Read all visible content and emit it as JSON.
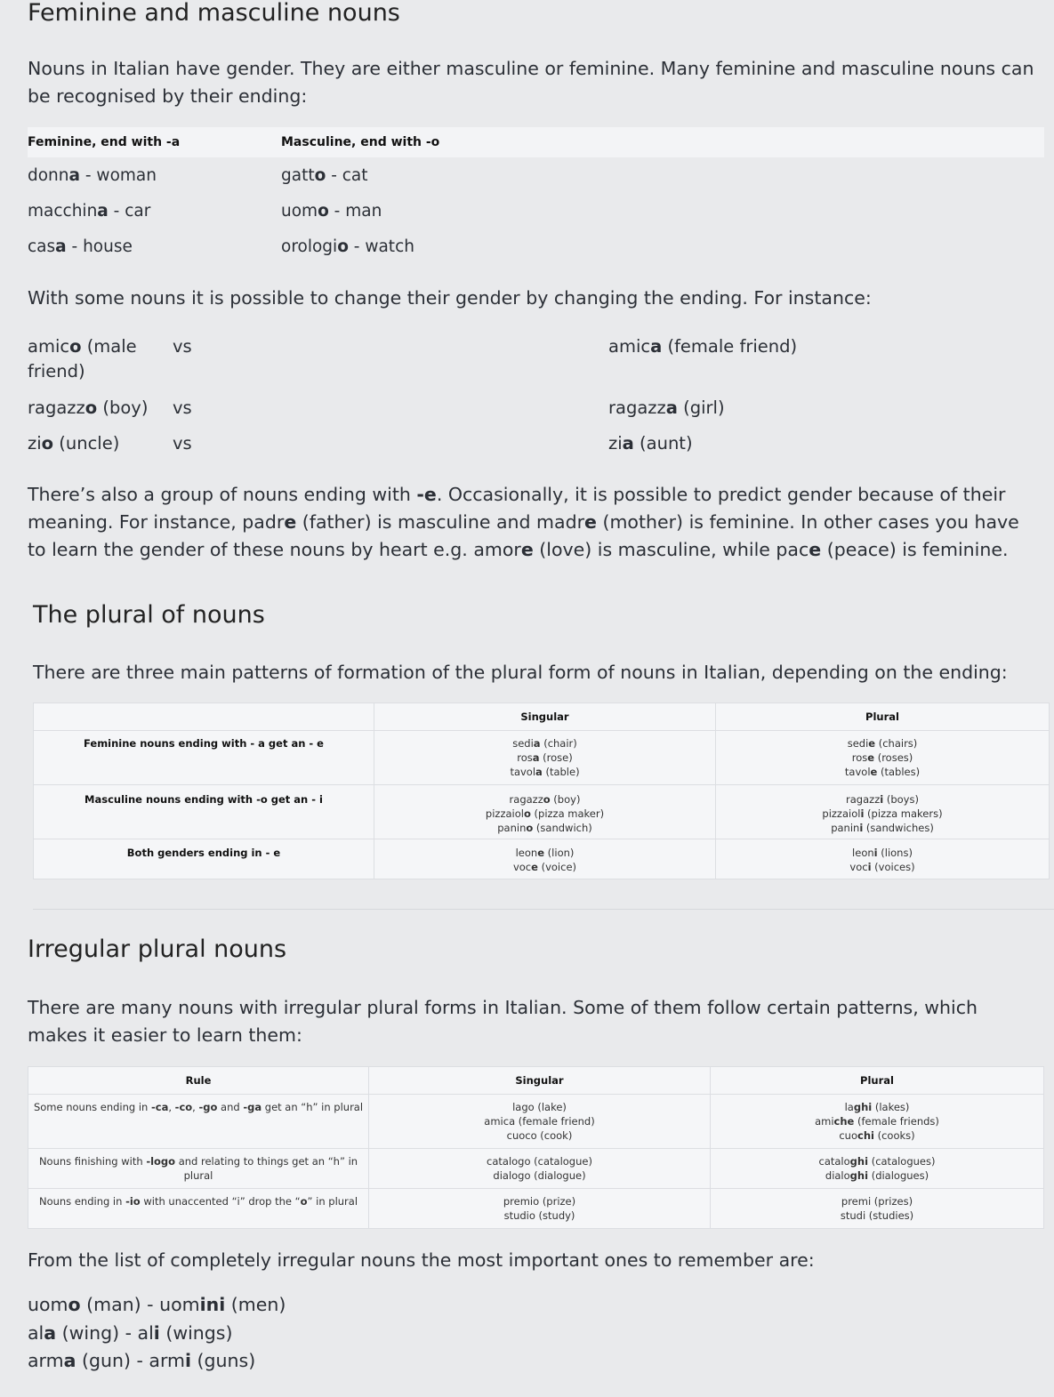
{
  "h_gender": "Feminine and masculine nouns",
  "p_intro": "Nouns in Italian have gender. They are either masculine or feminine. Many feminine and masculine nouns can be recognised by their ending:",
  "gender_table": {
    "head_fem": "Feminine, end with -a",
    "head_masc": "Masculine, end with -o",
    "rows": [
      {
        "fem": [
          {
            "t": "donn"
          },
          {
            "t": "a",
            "b": 1
          },
          {
            "t": " - woman"
          }
        ],
        "masc": [
          {
            "t": "gatt"
          },
          {
            "t": "o",
            "b": 1
          },
          {
            "t": " - cat"
          }
        ]
      },
      {
        "fem": [
          {
            "t": "macchin"
          },
          {
            "t": "a",
            "b": 1
          },
          {
            "t": " - car"
          }
        ],
        "masc": [
          {
            "t": "uom"
          },
          {
            "t": "o",
            "b": 1
          },
          {
            "t": " - man"
          }
        ]
      },
      {
        "fem": [
          {
            "t": "cas"
          },
          {
            "t": "a",
            "b": 1
          },
          {
            "t": " - house"
          }
        ],
        "masc": [
          {
            "t": "orologi"
          },
          {
            "t": "o",
            "b": 1
          },
          {
            "t": " - watch"
          }
        ]
      }
    ]
  },
  "p_change": "With some nouns it is possible to change their gender by changing the ending. For instance:",
  "change_rows": [
    {
      "left": [
        {
          "t": "amic"
        },
        {
          "t": "o",
          "b": 1
        },
        {
          "t": " (male friend)"
        }
      ],
      "vs": "vs",
      "right": [
        {
          "t": "amic"
        },
        {
          "t": "a",
          "b": 1
        },
        {
          "t": " (female friend)"
        }
      ]
    },
    {
      "left": [
        {
          "t": "ragazz"
        },
        {
          "t": "o",
          "b": 1
        },
        {
          "t": " (boy)"
        }
      ],
      "vs": "vs",
      "right": [
        {
          "t": "ragazz"
        },
        {
          "t": "a",
          "b": 1
        },
        {
          "t": " (girl)"
        }
      ]
    },
    {
      "left": [
        {
          "t": "zi"
        },
        {
          "t": "o",
          "b": 1
        },
        {
          "t": " (uncle)"
        }
      ],
      "vs": "vs",
      "right": [
        {
          "t": "zi"
        },
        {
          "t": "a",
          "b": 1
        },
        {
          "t": " (aunt)"
        }
      ]
    }
  ],
  "p_e_group": [
    {
      "t": "There’s also a group of nouns ending with "
    },
    {
      "t": "-e",
      "b": 1
    },
    {
      "t": ". Occasionally, it is possible to predict gender because of their meaning. For instance, padr"
    },
    {
      "t": "e",
      "b": 1
    },
    {
      "t": " (father) is masculine and madr"
    },
    {
      "t": "e",
      "b": 1
    },
    {
      "t": " (mother) is feminine. In other cases you have to learn the gender of these nouns by heart e.g. amor"
    },
    {
      "t": "e",
      "b": 1
    },
    {
      "t": " (love) is masculine, while pac"
    },
    {
      "t": "e",
      "b": 1
    },
    {
      "t": " (peace) is feminine."
    }
  ],
  "h_plural": "The plural of nouns",
  "p_plural": "There are three main patterns of formation of the plural form of nouns in Italian, depending on the ending:",
  "plural_table": {
    "head_singular": "Singular",
    "head_plural": "Plural",
    "rows": [
      {
        "rule": "Feminine nouns ending with - a get an - e",
        "singular": [
          [
            {
              "t": "sedi"
            },
            {
              "t": "a",
              "b": 1
            },
            {
              "t": " (chair)"
            }
          ],
          [
            {
              "t": "ros"
            },
            {
              "t": "a",
              "b": 1
            },
            {
              "t": " (rose)"
            }
          ],
          [
            {
              "t": "tavol"
            },
            {
              "t": "a",
              "b": 1
            },
            {
              "t": " (table)"
            }
          ]
        ],
        "plural": [
          [
            {
              "t": "sedi"
            },
            {
              "t": "e",
              "b": 1
            },
            {
              "t": " (chairs)"
            }
          ],
          [
            {
              "t": "ros"
            },
            {
              "t": "e",
              "b": 1
            },
            {
              "t": " (roses)"
            }
          ],
          [
            {
              "t": "tavol"
            },
            {
              "t": "e",
              "b": 1
            },
            {
              "t": " (tables)"
            }
          ]
        ]
      },
      {
        "rule": "Masculine nouns ending with -o get an - i",
        "singular": [
          [
            {
              "t": "ragazz"
            },
            {
              "t": "o",
              "b": 1
            },
            {
              "t": " (boy)"
            }
          ],
          [
            {
              "t": "pizzaiol"
            },
            {
              "t": "o",
              "b": 1
            },
            {
              "t": " (pizza maker)"
            }
          ],
          [
            {
              "t": "panin"
            },
            {
              "t": "o",
              "b": 1
            },
            {
              "t": " (sandwich)"
            }
          ]
        ],
        "plural": [
          [
            {
              "t": "ragazz"
            },
            {
              "t": "i",
              "b": 1
            },
            {
              "t": " (boys)"
            }
          ],
          [
            {
              "t": "pizzaiol"
            },
            {
              "t": "i",
              "b": 1
            },
            {
              "t": " (pizza makers)"
            }
          ],
          [
            {
              "t": "panin"
            },
            {
              "t": "i",
              "b": 1
            },
            {
              "t": " (sandwiches)"
            }
          ]
        ]
      },
      {
        "rule": "Both genders ending in - e",
        "singular": [
          [
            {
              "t": "leon"
            },
            {
              "t": "e",
              "b": 1
            },
            {
              "t": " (lion)"
            }
          ],
          [
            {
              "t": "voc"
            },
            {
              "t": "e",
              "b": 1
            },
            {
              "t": " (voice)"
            }
          ]
        ],
        "plural": [
          [
            {
              "t": "leon"
            },
            {
              "t": "i",
              "b": 1
            },
            {
              "t": " (lions)"
            }
          ],
          [
            {
              "t": "voc"
            },
            {
              "t": "i",
              "b": 1
            },
            {
              "t": " (voices)"
            }
          ]
        ]
      }
    ]
  },
  "h_irregular": "Irregular plural nouns",
  "p_irregular": "There are many nouns with irregular plural forms in Italian. Some of them follow certain patterns, which makes it easier to learn them:",
  "irregular_table": {
    "head_rule": "Rule",
    "head_singular": "Singular",
    "head_plural": "Plural",
    "rows": [
      {
        "rule": [
          {
            "t": "Some nouns ending in "
          },
          {
            "t": "-ca",
            "b": 1
          },
          {
            "t": ", "
          },
          {
            "t": "-co",
            "b": 1
          },
          {
            "t": ", "
          },
          {
            "t": "-go",
            "b": 1
          },
          {
            "t": " and "
          },
          {
            "t": "-ga",
            "b": 1
          },
          {
            "t": " get an “h” in plural"
          }
        ],
        "singular": [
          [
            {
              "t": "lago (lake)"
            }
          ],
          [
            {
              "t": "amica (female friend)"
            }
          ],
          [
            {
              "t": "cuoco (cook)"
            }
          ]
        ],
        "plural": [
          [
            {
              "t": "la"
            },
            {
              "t": "ghi",
              "b": 1
            },
            {
              "t": " (lakes)"
            }
          ],
          [
            {
              "t": "ami"
            },
            {
              "t": "che",
              "b": 1
            },
            {
              "t": " (female friends)"
            }
          ],
          [
            {
              "t": "cuo"
            },
            {
              "t": "chi",
              "b": 1
            },
            {
              "t": " (cooks)"
            }
          ]
        ]
      },
      {
        "rule": [
          {
            "t": "Nouns finishing with "
          },
          {
            "t": "-logo",
            "b": 1
          },
          {
            "t": " and relating to things get an “h” in plural"
          }
        ],
        "singular": [
          [
            {
              "t": "catalogo (catalogue)"
            }
          ],
          [
            {
              "t": "dialogo (dialogue)"
            }
          ]
        ],
        "plural": [
          [
            {
              "t": "catalo"
            },
            {
              "t": "ghi",
              "b": 1
            },
            {
              "t": " (catalogues)"
            }
          ],
          [
            {
              "t": "dialo"
            },
            {
              "t": "ghi",
              "b": 1
            },
            {
              "t": " (dialogues)"
            }
          ]
        ]
      },
      {
        "rule": [
          {
            "t": "Nouns ending in "
          },
          {
            "t": "-io",
            "b": 1
          },
          {
            "t": " with unaccented “i” drop the “"
          },
          {
            "t": "o",
            "b": 1
          },
          {
            "t": "” in plural"
          }
        ],
        "singular": [
          [
            {
              "t": "premio (prize)"
            }
          ],
          [
            {
              "t": "studio (study)"
            }
          ]
        ],
        "plural": [
          [
            {
              "t": "premi (prizes)"
            }
          ],
          [
            {
              "t": "studi (studies)"
            }
          ]
        ]
      }
    ]
  },
  "p_completely": "From the list of completely irregular nouns the most important ones to remember are:",
  "irregular_list": [
    [
      {
        "t": "uom"
      },
      {
        "t": "o",
        "b": 1
      },
      {
        "t": " (man) - uom"
      },
      {
        "t": "ini",
        "b": 1
      },
      {
        "t": " (men)"
      }
    ],
    [
      {
        "t": "al"
      },
      {
        "t": "a",
        "b": 1
      },
      {
        "t": " (wing) - al"
      },
      {
        "t": "i",
        "b": 1
      },
      {
        "t": " (wings)"
      }
    ],
    [
      {
        "t": "arm"
      },
      {
        "t": "a",
        "b": 1
      },
      {
        "t": " (gun) - arm"
      },
      {
        "t": "i",
        "b": 1
      },
      {
        "t": " (guns)"
      }
    ]
  ]
}
